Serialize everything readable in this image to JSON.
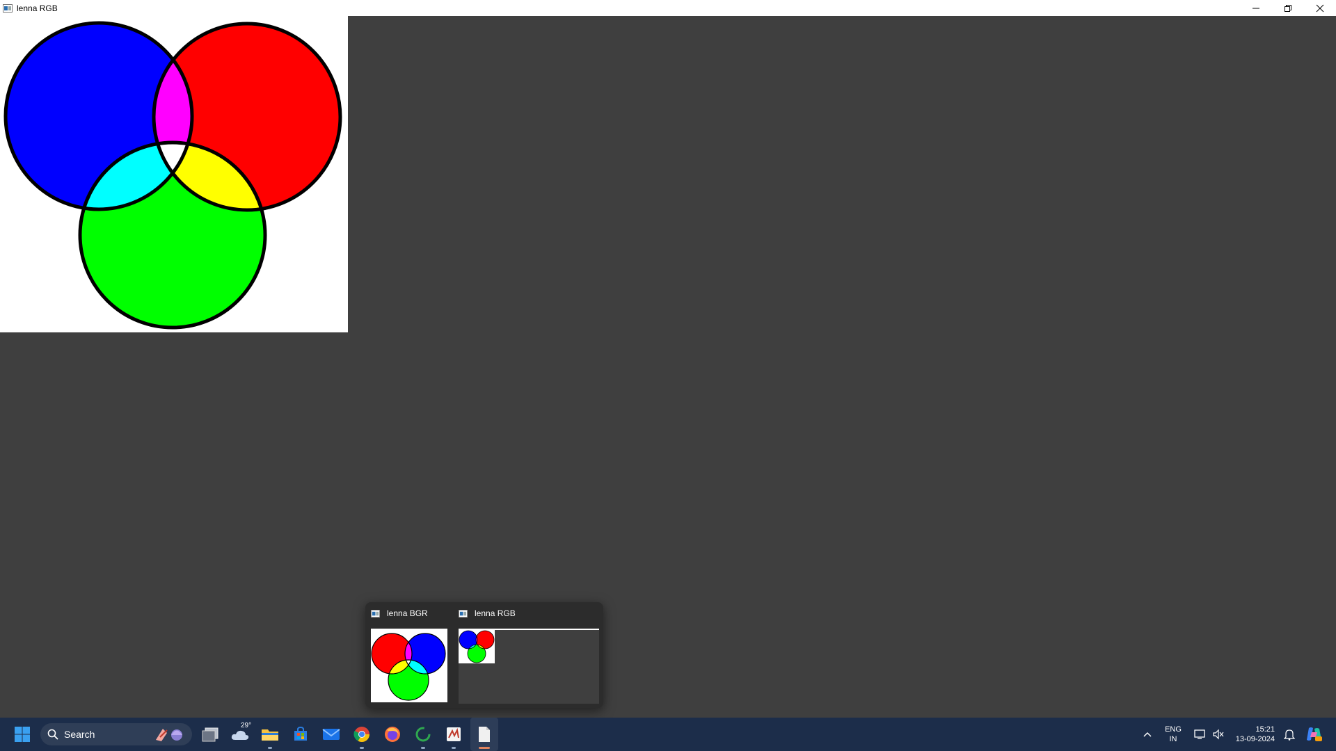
{
  "window": {
    "title": "lenna RGB"
  },
  "venn": {
    "circles": [
      {
        "color_name": "blue",
        "fill": "#0000ff"
      },
      {
        "color_name": "red",
        "fill": "#ff0000"
      },
      {
        "color_name": "green",
        "fill": "#00ff00"
      }
    ],
    "overlaps": [
      {
        "color_name": "magenta",
        "fill": "#ff00ff"
      },
      {
        "color_name": "cyan",
        "fill": "#00ffff"
      },
      {
        "color_name": "yellow",
        "fill": "#ffff00"
      },
      {
        "color_name": "white",
        "fill": "#ffffff"
      }
    ]
  },
  "preview": {
    "items": [
      {
        "title": "lenna BGR"
      },
      {
        "title": "lenna RGB"
      }
    ]
  },
  "taskbar": {
    "search_placeholder": "Search",
    "weather_temp": "29°",
    "apps": [
      "windows-start-icon",
      "task-view-icon",
      "weather-icon",
      "file-explorer-icon",
      "store-icon",
      "mail-icon",
      "chrome-icon",
      "firefox-icon",
      "loading-app-icon",
      "paint-app-icon",
      "document-app-icon"
    ],
    "tray": {
      "language_top": "ENG",
      "language_bottom": "IN",
      "time": "15:21",
      "date": "13-09-2024"
    }
  },
  "colors": {
    "desktop_bg": "#3f3f3f",
    "taskbar_bg": "#1c2d4a",
    "accent_active": "#e0845f"
  }
}
